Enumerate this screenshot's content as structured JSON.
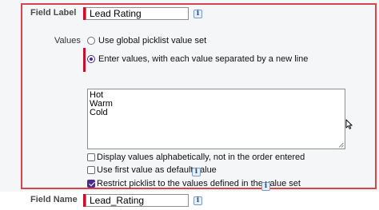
{
  "field_label": {
    "label": "Field Label",
    "value": "Lead Rating",
    "info_glyph": "i"
  },
  "values": {
    "label": "Values",
    "options": [
      {
        "label": "Use global picklist value set",
        "selected": false
      },
      {
        "label": "Enter values, with each value separated by a new line",
        "selected": true
      }
    ],
    "entries": [
      "Hot",
      "Warm",
      "Cold"
    ]
  },
  "checkboxes": [
    {
      "label": "Display values alphabetically, not in the order entered",
      "checked": false
    },
    {
      "label": "Use first value as default value",
      "checked": false,
      "info_glyph": "i"
    },
    {
      "label": "Restrict picklist to the values defined in the value set",
      "checked": true,
      "info_glyph": "i"
    }
  ],
  "field_name": {
    "label": "Field Name",
    "value": "Lead_Rating",
    "info_glyph": "i"
  },
  "colors": {
    "required_bar": "#c8102e",
    "focus_frame": "#d9434a",
    "accent": "#4a2b8a",
    "panel_bg": "#f5f6f7"
  }
}
